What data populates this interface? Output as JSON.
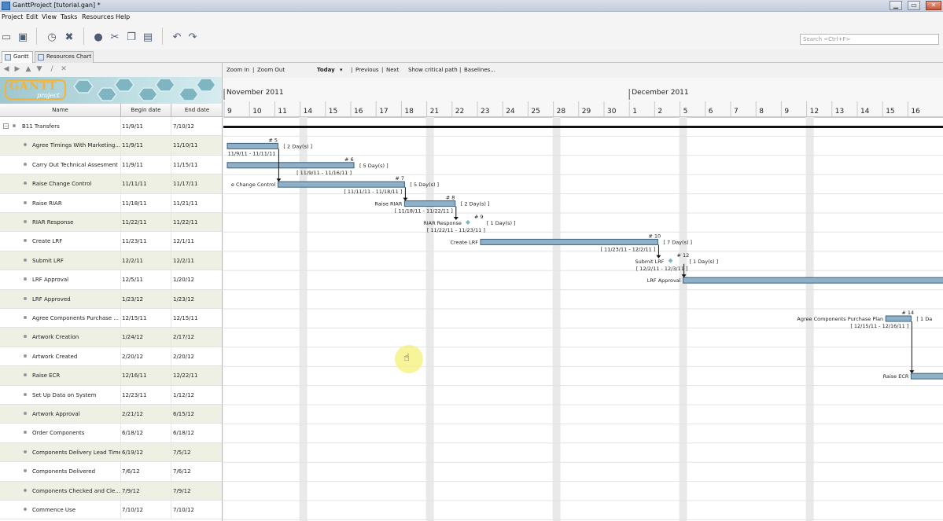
{
  "window": {
    "title": "GanttProject [tutorial.gan] *",
    "buttons": [
      "▁",
      "▭",
      "✕"
    ]
  },
  "menu": [
    "Project",
    "Edit",
    "View",
    "Tasks",
    "Resources",
    "Help"
  ],
  "toolbar": {
    "icons": [
      "open-icon",
      "save-icon",
      "history-icon",
      "delete-icon",
      "properties-icon",
      "cut-icon",
      "copy-icon",
      "paste-icon",
      "undo-icon",
      "redo-icon"
    ],
    "search_placeholder": "Search <Ctrl+F>"
  },
  "tabs": [
    {
      "label": "Gantt",
      "active": true
    },
    {
      "label": "Resources Chart",
      "active": false
    }
  ],
  "logo": {
    "text": "GANTT",
    "subtext": "project"
  },
  "columns": {
    "name": "Name",
    "begin": "Begin date",
    "end": "End date"
  },
  "tasks": [
    {
      "name": "B11 Transfers",
      "begin": "11/9/11",
      "end": "7/10/12",
      "group": true
    },
    {
      "name": "Agree Timings With Marketing...",
      "begin": "11/9/11",
      "end": "11/10/11"
    },
    {
      "name": "Carry Out Technical Assesment",
      "begin": "11/9/11",
      "end": "11/15/11"
    },
    {
      "name": "Raise Change Control",
      "begin": "11/11/11",
      "end": "11/17/11"
    },
    {
      "name": "Raise RIAR",
      "begin": "11/18/11",
      "end": "11/21/11"
    },
    {
      "name": "RIAR Response",
      "begin": "11/22/11",
      "end": "11/22/11"
    },
    {
      "name": "Create LRF",
      "begin": "11/23/11",
      "end": "12/1/11"
    },
    {
      "name": "Submit LRF",
      "begin": "12/2/11",
      "end": "12/2/11"
    },
    {
      "name": "LRF Approval",
      "begin": "12/5/11",
      "end": "1/20/12"
    },
    {
      "name": "LRF Approved",
      "begin": "1/23/12",
      "end": "1/23/12"
    },
    {
      "name": "Agree Components Purchase ...",
      "begin": "12/15/11",
      "end": "12/15/11"
    },
    {
      "name": "Artwork Creation",
      "begin": "1/24/12",
      "end": "2/17/12"
    },
    {
      "name": "Artwork Created",
      "begin": "2/20/12",
      "end": "2/20/12"
    },
    {
      "name": "Raise ECR",
      "begin": "12/16/11",
      "end": "12/22/11"
    },
    {
      "name": "Set Up Data on System",
      "begin": "12/23/11",
      "end": "1/12/12"
    },
    {
      "name": "Artwork Approval",
      "begin": "2/21/12",
      "end": "6/15/12"
    },
    {
      "name": "Order Components",
      "begin": "6/18/12",
      "end": "6/18/12"
    },
    {
      "name": "Components Delivery Lead Time",
      "begin": "6/19/12",
      "end": "7/5/12"
    },
    {
      "name": "Components Delivered",
      "begin": "7/6/12",
      "end": "7/6/12"
    },
    {
      "name": "Components Checked and Cle...",
      "begin": "7/9/12",
      "end": "7/9/12"
    },
    {
      "name": "Commence Use",
      "begin": "7/10/12",
      "end": "7/10/12"
    }
  ],
  "chart_toolbar": {
    "zoom_in": "Zoom In",
    "zoom_out": "Zoom Out",
    "today": "Today",
    "previous": "Previous",
    "next": "Next",
    "critical": "Show critical path",
    "baselines": "Baselines..."
  },
  "timeline": {
    "months": [
      {
        "label": "November 2011",
        "day_index": 0
      },
      {
        "label": "December 2011",
        "day_index": 16
      }
    ],
    "days": [
      "9",
      "10",
      "11",
      "14",
      "15",
      "16",
      "17",
      "18",
      "21",
      "22",
      "23",
      "24",
      "25",
      "28",
      "29",
      "30",
      "1",
      "2",
      "5",
      "6",
      "7",
      "8",
      "9",
      "12",
      "13",
      "14",
      "15",
      "16"
    ],
    "week_breaks": [
      3,
      8,
      13,
      18,
      23
    ]
  },
  "gantt_bars": [
    {
      "row": 1,
      "type": "bar",
      "start": 0,
      "end": 2,
      "num": "# 5",
      "label": "",
      "duration": "[ 2 Day(s) ]",
      "dates": "11/9/11 - 11/11/11"
    },
    {
      "row": 2,
      "type": "bar",
      "start": 0,
      "end": 5,
      "num": "# 6",
      "label": "",
      "duration": "[ 5 Day(s) ]",
      "dates": "[ 11/9/11 - 11/16/11 ]"
    },
    {
      "row": 3,
      "type": "bar",
      "start": 2,
      "end": 7,
      "num": "# 7",
      "label": "e Change Control",
      "duration": "[ 5 Day(s) ]",
      "dates": "[ 11/11/11 - 11/18/11 ]"
    },
    {
      "row": 4,
      "type": "bar",
      "start": 7,
      "end": 9,
      "num": "# 8",
      "label": "Raise RIAR",
      "duration": "[ 2 Day(s) ]",
      "dates": "[ 11/18/11 - 11/22/11 ]"
    },
    {
      "row": 5,
      "type": "milestone",
      "start": 9.5,
      "end": 9.5,
      "num": "# 9",
      "label": "RIAR Response",
      "duration": "[ 1 Day(s) ]",
      "dates": "[ 11/22/11 - 11/23/11 ]"
    },
    {
      "row": 6,
      "type": "bar",
      "start": 10,
      "end": 17,
      "num": "# 10",
      "label": "Create LRF",
      "duration": "[ 7 Day(s) ]",
      "dates": "[ 11/23/11 - 12/2/11 ]"
    },
    {
      "row": 7,
      "type": "milestone",
      "start": 17.5,
      "end": 17.5,
      "num": "# 12",
      "label": "Submit LRF",
      "duration": "[ 1 Day(s) ]",
      "dates": "[ 12/2/11 - 12/3/11 ]"
    },
    {
      "row": 8,
      "type": "bar",
      "start": 18,
      "end": 29,
      "num": "",
      "label": "LRF Approval",
      "duration": "",
      "dates": ""
    },
    {
      "row": 10,
      "type": "bar",
      "start": 26,
      "end": 27,
      "num": "# 14",
      "label": "Agree Components Purchase Plan",
      "duration": "[ 1 Da",
      "dates": "[ 12/15/11 - 12/16/11 ]"
    },
    {
      "row": 13,
      "type": "bar",
      "start": 27,
      "end": 29,
      "num": "",
      "label": "Raise ECR",
      "duration": "",
      "dates": ""
    }
  ],
  "dependencies": [
    {
      "from_row": 1,
      "from_end": 2,
      "to_row": 3
    },
    {
      "from_row": 3,
      "from_end": 7,
      "to_row": 4
    },
    {
      "from_row": 4,
      "from_end": 9,
      "to_row": 5
    },
    {
      "from_row": 6,
      "from_end": 17,
      "to_row": 7
    },
    {
      "from_row": 7,
      "from_end": 18,
      "to_row": 8
    },
    {
      "from_row": 10,
      "from_end": 27,
      "to_row": 13
    }
  ]
}
